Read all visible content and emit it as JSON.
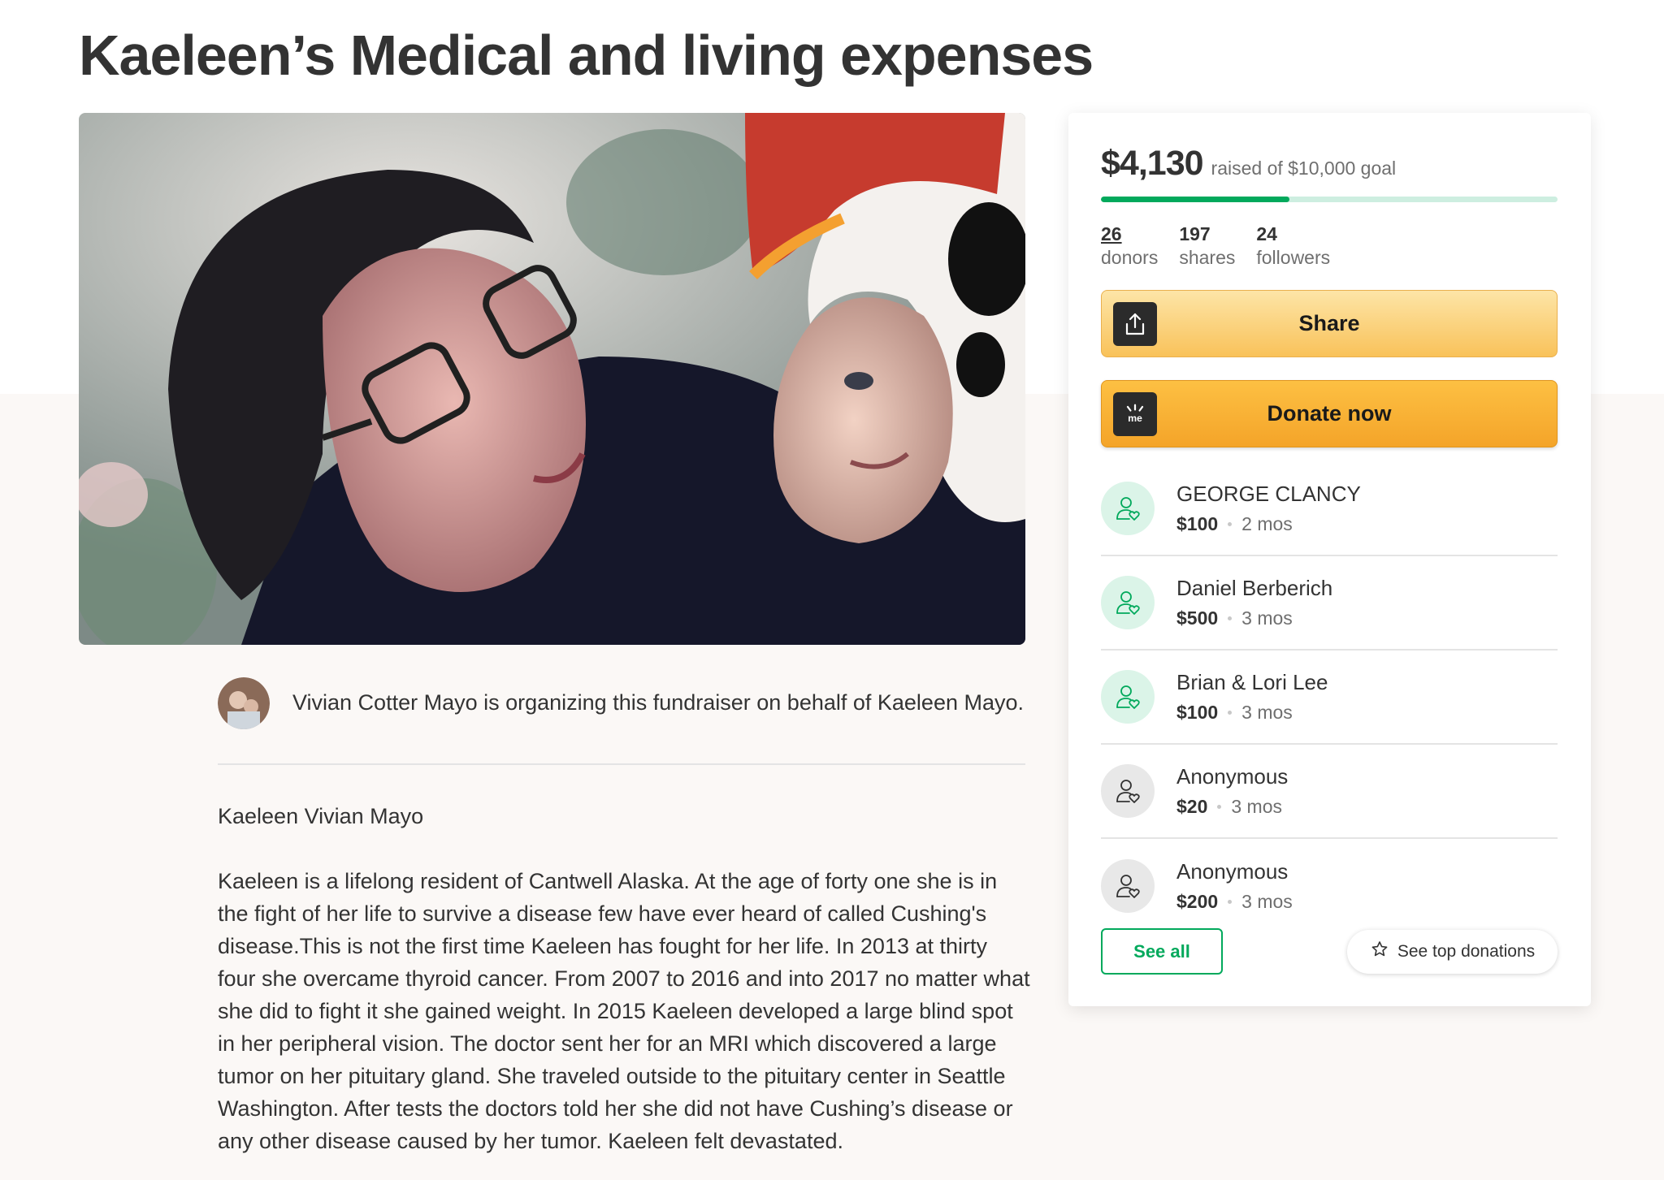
{
  "page": {
    "title": "Kaeleen’s Medical and living expenses"
  },
  "hero": {
    "image_alt": "photo-woman-and-child"
  },
  "organizer": {
    "text": "Vivian Cotter Mayo is organizing this fundraiser on behalf of Kaeleen Mayo."
  },
  "story": {
    "name": "Kaeleen Vivian Mayo",
    "body": "Kaeleen is a lifelong resident of Cantwell Alaska. At the age of forty one she is in the fight of her life to survive a disease few have ever heard of called Cushing's disease.This is not the first time Kaeleen has fought for her life. In 2013 at thirty four she overcame thyroid cancer. From 2007 to 2016 and into 2017 no matter what she did to fight it she gained weight. In 2015 Kaeleen developed a large blind spot in her peripheral vision. The doctor sent her for an MRI which discovered a large tumor on her pituitary gland. She traveled outside to the pituitary center in Seattle Washington. After tests the doctors told her she did not have Cushing’s disease or any other disease caused by her tumor. Kaeleen felt devastated."
  },
  "card": {
    "amount": "$4,130",
    "goal_text": "raised of $10,000 goal",
    "progress_fraction": 0.413,
    "stats": [
      {
        "value": "26",
        "label": "donors"
      },
      {
        "value": "197",
        "label": "shares"
      },
      {
        "value": "24",
        "label": "followers"
      }
    ],
    "share_label": "Share",
    "donate_label": "Donate now",
    "donations": [
      {
        "name": "GEORGE CLANCY",
        "amount": "$100",
        "time": "2 mos",
        "avatar": "green"
      },
      {
        "name": "Daniel Berberich",
        "amount": "$500",
        "time": "3 mos",
        "avatar": "green"
      },
      {
        "name": "Brian & Lori Lee",
        "amount": "$100",
        "time": "3 mos",
        "avatar": "green"
      },
      {
        "name": "Anonymous",
        "amount": "$20",
        "time": "3 mos",
        "avatar": "gray"
      },
      {
        "name": "Anonymous",
        "amount": "$200",
        "time": "3 mos",
        "avatar": "gray"
      }
    ],
    "see_all_label": "See all",
    "see_top_label": "See top donations"
  },
  "colors": {
    "brand_green": "#02a95c",
    "donate_orange": "#f4a429",
    "share_yellow": "#f9c25a"
  },
  "icons": {
    "share": "share-upload-icon",
    "donate": "gofundme-logo-icon",
    "donor": "person-heart-icon",
    "star": "star-outline-icon"
  }
}
